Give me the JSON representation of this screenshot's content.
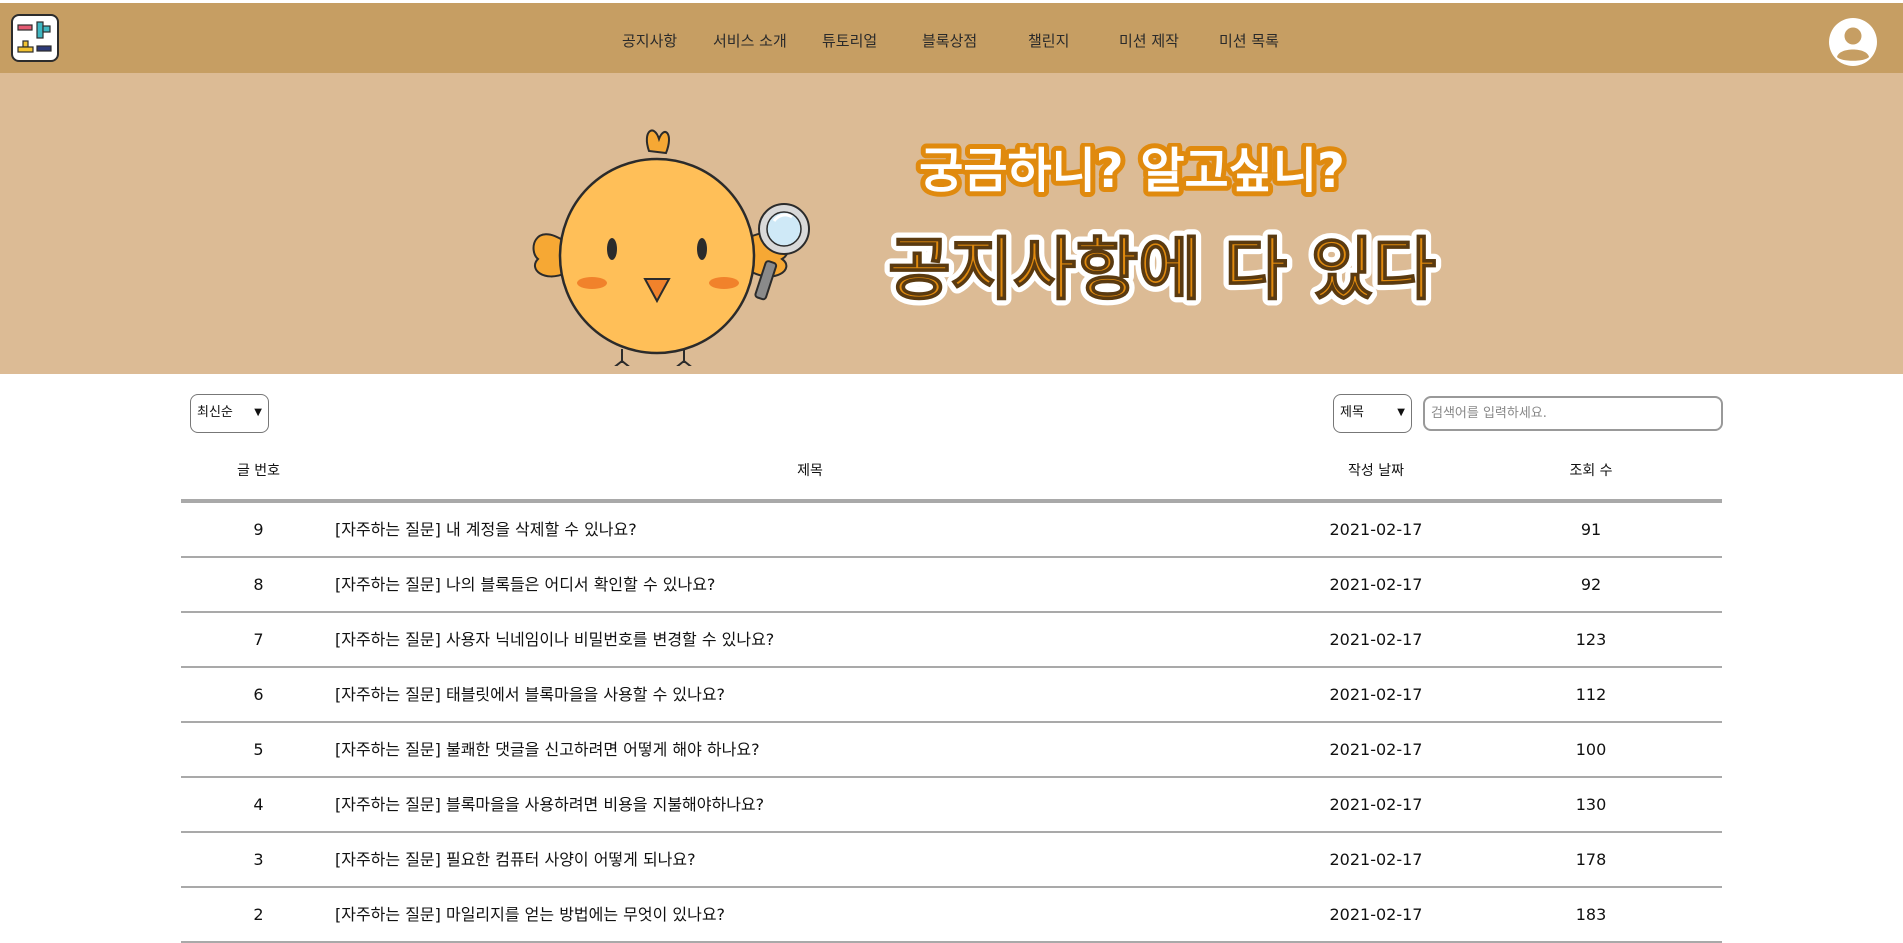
{
  "nav": {
    "items": [
      {
        "label": "공지사항"
      },
      {
        "label": "서비스 소개"
      },
      {
        "label": "튜토리얼"
      },
      {
        "label": "블록상점"
      },
      {
        "label": "챌린지"
      },
      {
        "label": "미션 제작"
      },
      {
        "label": "미션 목록"
      }
    ]
  },
  "banner": {
    "line1": "궁금하니? 알고싶니?",
    "line2": "공지사항에 다 있다",
    "text_fill": "#ffffff",
    "text_stroke": "#e08a0e"
  },
  "controls": {
    "sort_value": "최신순",
    "field_value": "제목",
    "search_placeholder": "검색어를 입력하세요."
  },
  "table": {
    "headers": {
      "number": "글 번호",
      "title": "제목",
      "date": "작성 날짜",
      "views": "조회 수"
    },
    "rows": [
      {
        "number": "9",
        "title": "[자주하는 질문] 내 계정을 삭제할 수 있나요?",
        "date": "2021-02-17",
        "views": "91"
      },
      {
        "number": "8",
        "title": "[자주하는 질문] 나의 블록들은 어디서 확인할 수 있나요?",
        "date": "2021-02-17",
        "views": "92"
      },
      {
        "number": "7",
        "title": "[자주하는 질문] 사용자 닉네임이나 비밀번호를 변경할 수 있나요?",
        "date": "2021-02-17",
        "views": "123"
      },
      {
        "number": "6",
        "title": "[자주하는 질문] 태블릿에서 블록마을을 사용할 수 있나요?",
        "date": "2021-02-17",
        "views": "112"
      },
      {
        "number": "5",
        "title": "[자주하는 질문] 불쾌한 댓글을 신고하려면 어떻게 해야 하나요?",
        "date": "2021-02-17",
        "views": "100"
      },
      {
        "number": "4",
        "title": "[자주하는 질문] 블록마을을 사용하려면 비용을 지불해야하나요?",
        "date": "2021-02-17",
        "views": "130"
      },
      {
        "number": "3",
        "title": "[자주하는 질문] 필요한 컴퓨터 사양이 어떻게 되나요?",
        "date": "2021-02-17",
        "views": "178"
      },
      {
        "number": "2",
        "title": "[자주하는 질문] 마일리지를 얻는 방법에는 무엇이 있나요?",
        "date": "2021-02-17",
        "views": "183"
      }
    ]
  },
  "colors": {
    "navbar": "#c69e63",
    "banner": "#dcbb95",
    "divider": "#a9a9a9"
  }
}
